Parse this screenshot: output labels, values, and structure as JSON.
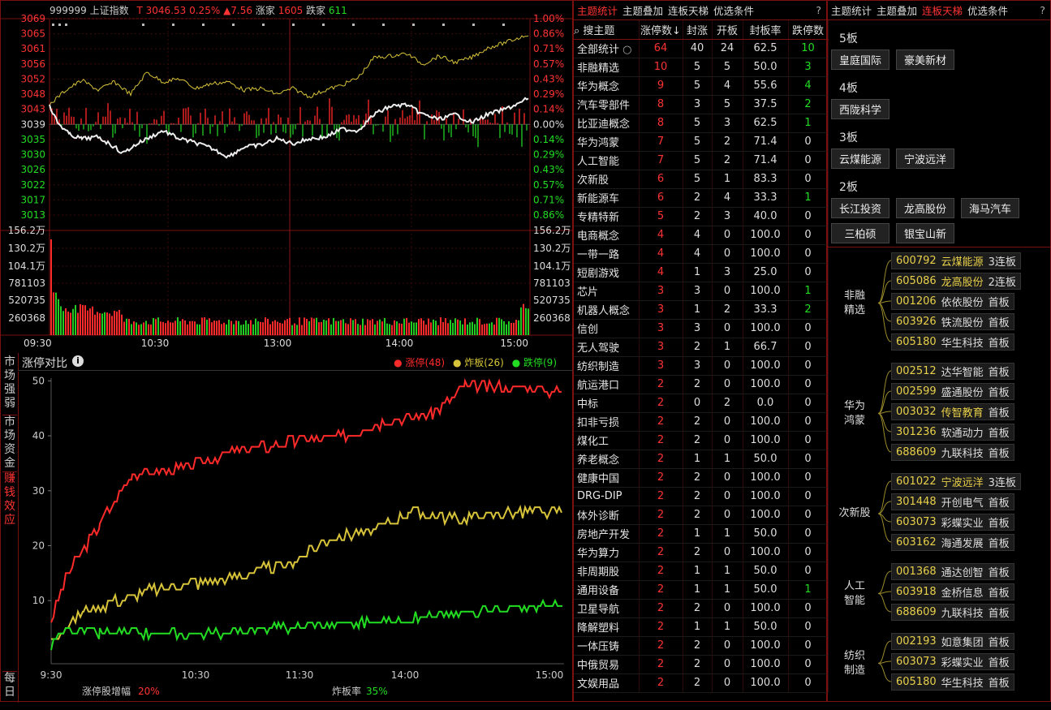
{
  "header": {
    "code": "999999",
    "name": "上证指数",
    "t": "T",
    "price": "3046.53",
    "pct": "0.25%",
    "chg": "▲7.56",
    "up_label": "涨家",
    "up": "1605",
    "down_label": "跌家",
    "down": "611"
  },
  "price_axis_left": [
    "3069",
    "3065",
    "3061",
    "3056",
    "3052",
    "3048",
    "3043",
    "3039",
    "3035",
    "3030",
    "3026",
    "3022",
    "3017",
    "3013"
  ],
  "price_axis_right": [
    "1.00%",
    "0.86%",
    "0.71%",
    "0.57%",
    "0.43%",
    "0.29%",
    "0.14%",
    "0.00%",
    "0.14%",
    "0.29%",
    "0.43%",
    "0.57%",
    "0.71%",
    "0.86%"
  ],
  "vol_axis_left": [
    "156.2万",
    "130.2万",
    "104.1万",
    "781103",
    "520735",
    "260368"
  ],
  "vol_axis_right": [
    "156.2万",
    "130.2万",
    "104.1万",
    "781103",
    "520735",
    "260368"
  ],
  "time_axis": [
    "09:30",
    "10:30",
    "13:00",
    "14:00",
    "15:00"
  ],
  "compare": {
    "title": "涨停对比",
    "legend": [
      {
        "label": "涨停(48)",
        "color": "#ff2a2a"
      },
      {
        "label": "炸板(26)",
        "color": "#d8c43a"
      },
      {
        "label": "跌停(9)",
        "color": "#22dd22"
      }
    ],
    "yticks": [
      "50",
      "40",
      "30",
      "20",
      "10"
    ],
    "xticks": [
      "9:30",
      "10:30",
      "11:30",
      "14:00",
      "15:00"
    ],
    "footer_l_label": "涨停股增幅",
    "footer_l_val": "20%",
    "footer_r_label": "炸板率",
    "footer_r_val": "35%"
  },
  "side_tabs": [
    "市场强弱",
    "市场资金",
    "赚钱效应",
    "每日"
  ],
  "mid": {
    "tabs": [
      "主题统计",
      "主题叠加",
      "连板天梯",
      "优选条件"
    ],
    "headers": [
      "搜主题",
      "涨停数↓",
      "封涨",
      "开板",
      "封板率",
      "跌停数"
    ],
    "rows": [
      [
        "全部统计",
        "64",
        "40",
        "24",
        "62.5",
        "10"
      ],
      [
        "非融精选",
        "10",
        "5",
        "5",
        "50.0",
        "3"
      ],
      [
        "华为概念",
        "9",
        "5",
        "4",
        "55.6",
        "4"
      ],
      [
        "汽车零部件",
        "8",
        "3",
        "5",
        "37.5",
        "2"
      ],
      [
        "比亚迪概念",
        "8",
        "5",
        "3",
        "62.5",
        "1"
      ],
      [
        "华为鸿蒙",
        "7",
        "5",
        "2",
        "71.4",
        "0"
      ],
      [
        "人工智能",
        "7",
        "5",
        "2",
        "71.4",
        "0"
      ],
      [
        "次新股",
        "6",
        "5",
        "1",
        "83.3",
        "0"
      ],
      [
        "新能源车",
        "6",
        "2",
        "4",
        "33.3",
        "1"
      ],
      [
        "专精特新",
        "5",
        "2",
        "3",
        "40.0",
        "0"
      ],
      [
        "电商概念",
        "4",
        "4",
        "0",
        "100.0",
        "0"
      ],
      [
        "一带一路",
        "4",
        "4",
        "0",
        "100.0",
        "0"
      ],
      [
        "短剧游戏",
        "4",
        "1",
        "3",
        "25.0",
        "0"
      ],
      [
        "芯片",
        "3",
        "3",
        "0",
        "100.0",
        "1"
      ],
      [
        "机器人概念",
        "3",
        "1",
        "2",
        "33.3",
        "2"
      ],
      [
        "信创",
        "3",
        "3",
        "0",
        "100.0",
        "0"
      ],
      [
        "无人驾驶",
        "3",
        "2",
        "1",
        "66.7",
        "0"
      ],
      [
        "纺织制造",
        "3",
        "3",
        "0",
        "100.0",
        "0"
      ],
      [
        "航运港口",
        "2",
        "2",
        "0",
        "100.0",
        "0"
      ],
      [
        "中标",
        "2",
        "0",
        "2",
        "0.0",
        "0"
      ],
      [
        "扣非亏损",
        "2",
        "2",
        "0",
        "100.0",
        "0"
      ],
      [
        "煤化工",
        "2",
        "2",
        "0",
        "100.0",
        "0"
      ],
      [
        "养老概念",
        "2",
        "1",
        "1",
        "50.0",
        "0"
      ],
      [
        "健康中国",
        "2",
        "2",
        "0",
        "100.0",
        "0"
      ],
      [
        "DRG-DIP",
        "2",
        "2",
        "0",
        "100.0",
        "0"
      ],
      [
        "体外诊断",
        "2",
        "2",
        "0",
        "100.0",
        "0"
      ],
      [
        "房地产开发",
        "2",
        "1",
        "1",
        "50.0",
        "0"
      ],
      [
        "华为算力",
        "2",
        "2",
        "0",
        "100.0",
        "0"
      ],
      [
        "非周期股",
        "2",
        "1",
        "1",
        "50.0",
        "0"
      ],
      [
        "通用设备",
        "2",
        "1",
        "1",
        "50.0",
        "1"
      ],
      [
        "卫星导航",
        "2",
        "2",
        "0",
        "100.0",
        "0"
      ],
      [
        "降解塑料",
        "2",
        "1",
        "1",
        "50.0",
        "0"
      ],
      [
        "一体压铸",
        "2",
        "2",
        "0",
        "100.0",
        "0"
      ],
      [
        "中俄贸易",
        "2",
        "2",
        "0",
        "100.0",
        "0"
      ],
      [
        "文娱用品",
        "2",
        "2",
        "0",
        "100.0",
        "0"
      ]
    ]
  },
  "right": {
    "tabs": [
      "主题统计",
      "主题叠加",
      "连板天梯",
      "优选条件"
    ],
    "levels": [
      {
        "label": "5板",
        "stocks": [
          "皇庭国际",
          "豪美新材"
        ]
      },
      {
        "label": "4板",
        "stocks": [
          "西陇科学"
        ]
      },
      {
        "label": "3板",
        "stocks": [
          "云煤能源",
          "宁波远洋"
        ]
      },
      {
        "label": "2板",
        "stocks": [
          "长江投资",
          "龙高股份",
          "海马汽车",
          "三柏硕",
          "银宝山新"
        ]
      }
    ],
    "groups": [
      {
        "label": "非融\n精选",
        "items": [
          [
            "600792",
            "云煤能源",
            "3连板",
            1
          ],
          [
            "605086",
            "龙高股份",
            "2连板",
            1
          ],
          [
            "001206",
            "依依股份",
            "首板",
            0
          ],
          [
            "603926",
            "铁流股份",
            "首板",
            0
          ],
          [
            "605180",
            "华生科技",
            "首板",
            0
          ]
        ]
      },
      {
        "label": "华为\n鸿蒙",
        "items": [
          [
            "002512",
            "达华智能",
            "首板",
            0
          ],
          [
            "002599",
            "盛通股份",
            "首板",
            0
          ],
          [
            "003032",
            "传智教育",
            "首板",
            1
          ],
          [
            "301236",
            "软通动力",
            "首板",
            0
          ],
          [
            "688609",
            "九联科技",
            "首板",
            0
          ]
        ]
      },
      {
        "label": "次新股",
        "items": [
          [
            "601022",
            "宁波远洋",
            "3连板",
            1
          ],
          [
            "301448",
            "开创电气",
            "首板",
            0
          ],
          [
            "603073",
            "彩蝶实业",
            "首板",
            0
          ],
          [
            "603162",
            "海通发展",
            "首板",
            0
          ]
        ]
      },
      {
        "label": "人工\n智能",
        "items": [
          [
            "001368",
            "通达创智",
            "首板",
            0
          ],
          [
            "603918",
            "金桥信息",
            "首板",
            0
          ],
          [
            "688609",
            "九联科技",
            "首板",
            0
          ]
        ]
      },
      {
        "label": "纺织\n制造",
        "items": [
          [
            "002193",
            "如意集团",
            "首板",
            0
          ],
          [
            "603073",
            "彩蝶实业",
            "首板",
            0
          ],
          [
            "605180",
            "华生科技",
            "首板",
            0
          ]
        ]
      }
    ]
  }
}
